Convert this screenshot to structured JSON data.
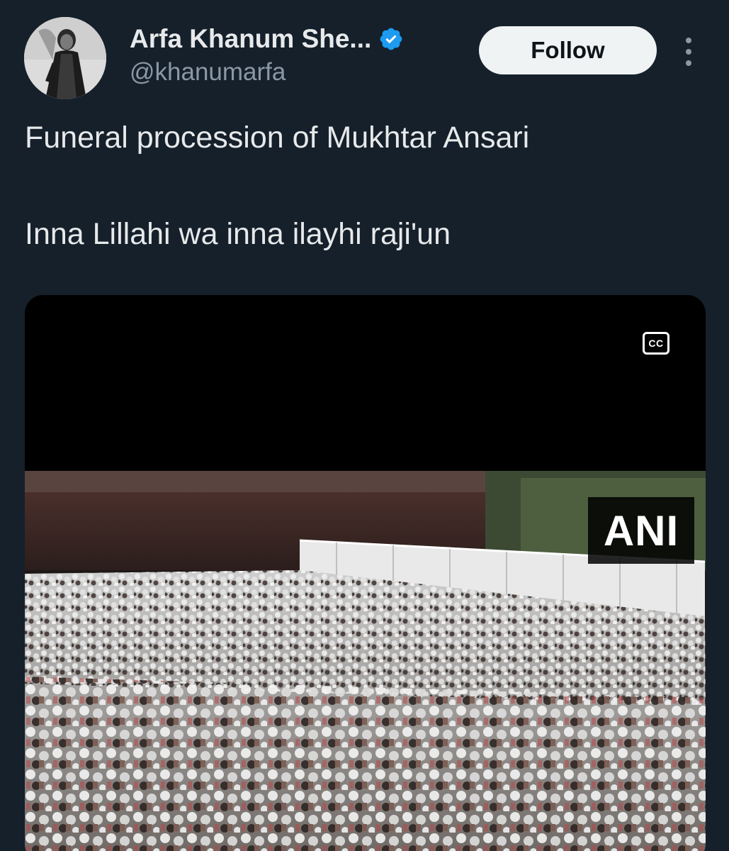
{
  "author": {
    "display_name": "Arfa Khanum She...",
    "handle": "@khanumarfa",
    "verified": true
  },
  "follow_button_label": "Follow",
  "tweet": {
    "text_lines": [
      "Funeral procession of Mukhtar Ansari",
      "Inna Lillahi wa inna ilayhi raji'un"
    ]
  },
  "video": {
    "captions_label": "CC",
    "watermark": "ANI"
  },
  "colors": {
    "background": "#15202b",
    "text_primary": "#e7e9ea",
    "text_secondary": "#8b98a5",
    "verified_blue": "#1d9bf0",
    "follow_button_bg": "#eff3f4"
  },
  "icons": {
    "verified": "verified-badge-icon",
    "more": "more-options-icon",
    "captions": "closed-captions-icon"
  }
}
